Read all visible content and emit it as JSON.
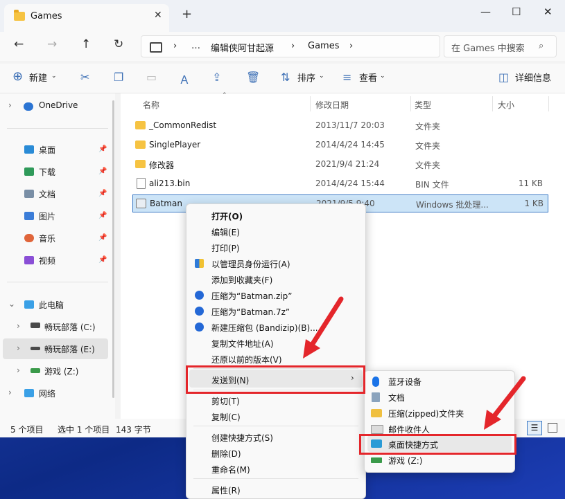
{
  "window": {
    "tab_title": "Games",
    "tab_close": "✕",
    "new_tab": "+",
    "minimize": "—",
    "maximize": "☐",
    "close": "✕"
  },
  "nav": {
    "back": "←",
    "forward": "→",
    "up": "↑",
    "refresh": "↻",
    "breadcrumb": [
      "…",
      "编辑侠阿甘起源",
      "Games"
    ],
    "search_placeholder": "在 Games 中搜索"
  },
  "toolbar": {
    "new_label": "新建",
    "sort_label": "排序",
    "view_label": "查看",
    "details_label": "详细信息"
  },
  "sidebar": {
    "onedrive": "OneDrive",
    "quick": [
      {
        "label": "桌面",
        "color": "#2a8bd6"
      },
      {
        "label": "下载",
        "color": "#2f9a5a"
      },
      {
        "label": "文档",
        "color": "#7a8fa6"
      },
      {
        "label": "图片",
        "color": "#3b7dd8"
      },
      {
        "label": "音乐",
        "color": "#e0653a"
      },
      {
        "label": "视频",
        "color": "#8a4fd6"
      }
    ],
    "thispc": "此电脑",
    "drives": [
      "畅玩部落 (C:)",
      "畅玩部落 (E:)",
      "游戏 (Z:)"
    ],
    "network": "网络"
  },
  "columns": {
    "name": "名称",
    "date": "修改日期",
    "type": "类型",
    "size": "大小"
  },
  "files": [
    {
      "name": "_CommonRedist",
      "date": "2013/11/7 20:03",
      "type": "文件夹",
      "size": ""
    },
    {
      "name": "SinglePlayer",
      "date": "2014/4/24 14:45",
      "type": "文件夹",
      "size": ""
    },
    {
      "name": "修改器",
      "date": "2021/9/4 21:24",
      "type": "文件夹",
      "size": ""
    },
    {
      "name": "ali213.bin",
      "date": "2014/4/24 15:44",
      "type": "BIN 文件",
      "size": "11 KB"
    },
    {
      "name": "Batman",
      "date": "2021/9/5 9:40",
      "type": "Windows 批处理...",
      "size": "1 KB"
    }
  ],
  "status": {
    "count": "5 个项目",
    "selected": "选中 1 个项目",
    "bytes": "143 字节"
  },
  "context_menu": {
    "items": [
      "打开(O)",
      "编辑(E)",
      "打印(P)",
      "以管理员身份运行(A)",
      "添加到收藏夹(F)",
      "压缩为“Batman.zip”",
      "压缩为“Batman.7z”",
      "新建压缩包 (Bandizip)(B)...",
      "复制文件地址(A)",
      "还原以前的版本(V)",
      "发送到(N)",
      "剪切(T)",
      "复制(C)",
      "创建快捷方式(S)",
      "删除(D)",
      "重命名(M)",
      "属性(R)"
    ]
  },
  "sendto_menu": {
    "items": [
      "蓝牙设备",
      "文档",
      "压缩(zipped)文件夹",
      "邮件收件人",
      "桌面快捷方式",
      "游戏 (Z:)"
    ]
  },
  "colors": {
    "highlight": "#e4262b",
    "selection": "#cce4f7",
    "accent": "#3b79c5"
  }
}
